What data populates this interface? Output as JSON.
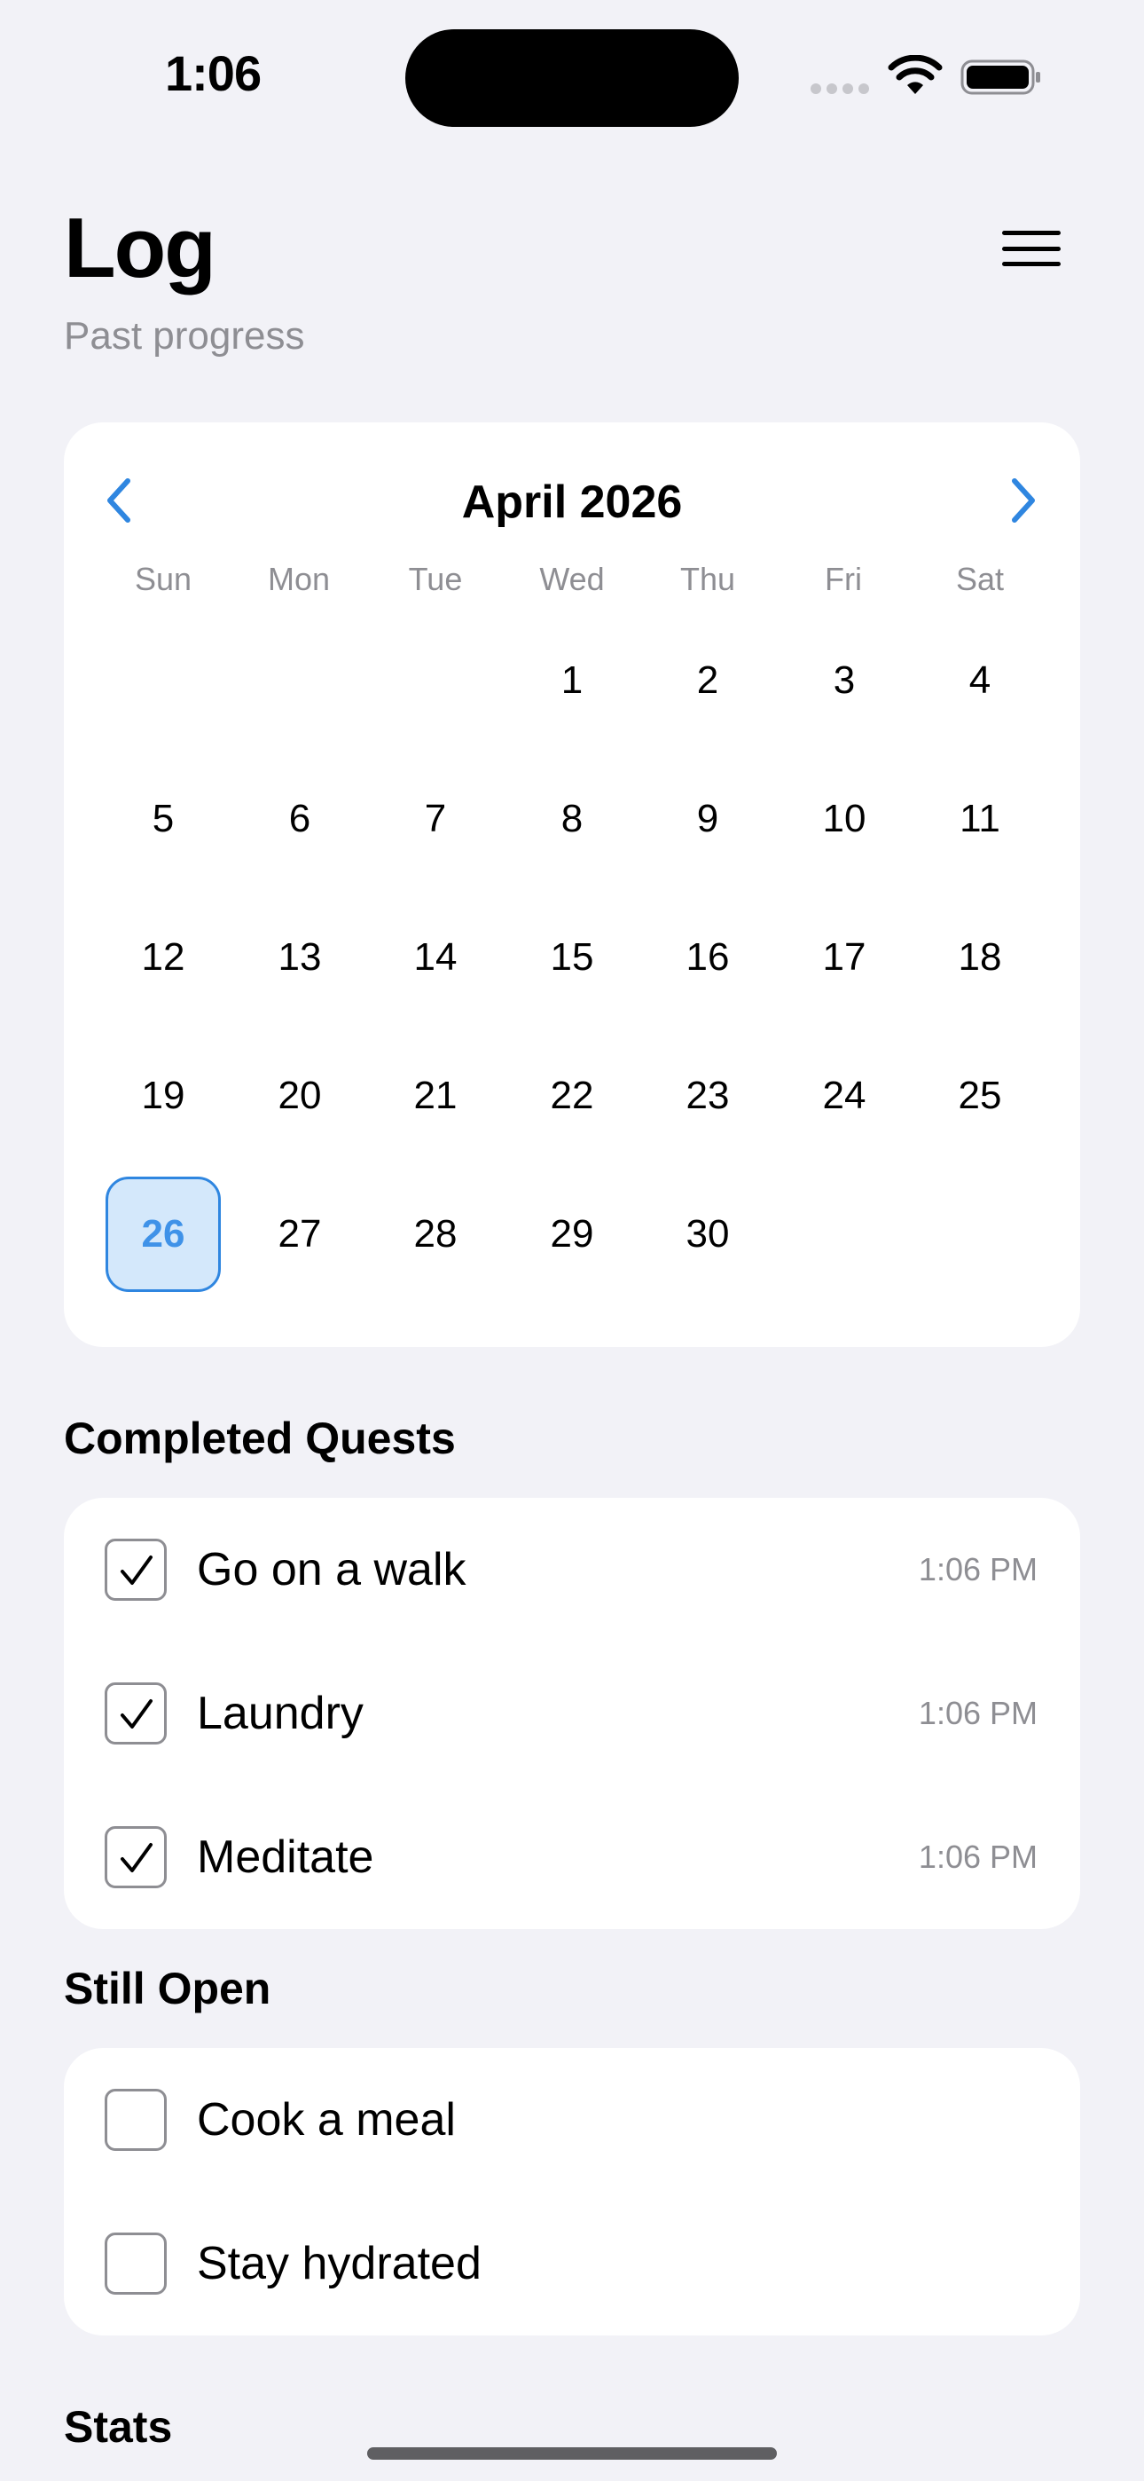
{
  "status_bar": {
    "time": "1:06"
  },
  "header": {
    "title": "Log",
    "subtitle": "Past progress",
    "menu_icon": "hamburger-menu-icon"
  },
  "calendar": {
    "month_label": "April 2026",
    "weekdays": [
      "Sun",
      "Mon",
      "Tue",
      "Wed",
      "Thu",
      "Fri",
      "Sat"
    ],
    "days": [
      "1",
      "2",
      "3",
      "4",
      "5",
      "6",
      "7",
      "8",
      "9",
      "10",
      "11",
      "12",
      "13",
      "14",
      "15",
      "16",
      "17",
      "18",
      "19",
      "20",
      "21",
      "22",
      "23",
      "24",
      "25",
      "26",
      "27",
      "28",
      "29",
      "30"
    ],
    "selected_day": "26",
    "accent_color": "#2f86e0"
  },
  "completed": {
    "heading": "Completed Quests",
    "items": [
      {
        "label": "Go on a walk",
        "time": "1:06 PM"
      },
      {
        "label": "Laundry",
        "time": "1:06 PM"
      },
      {
        "label": "Meditate",
        "time": "1:06 PM"
      }
    ]
  },
  "open": {
    "heading": "Still Open",
    "items": [
      {
        "label": "Cook a meal"
      },
      {
        "label": "Stay hydrated"
      }
    ]
  },
  "stats": {
    "heading": "Stats"
  }
}
